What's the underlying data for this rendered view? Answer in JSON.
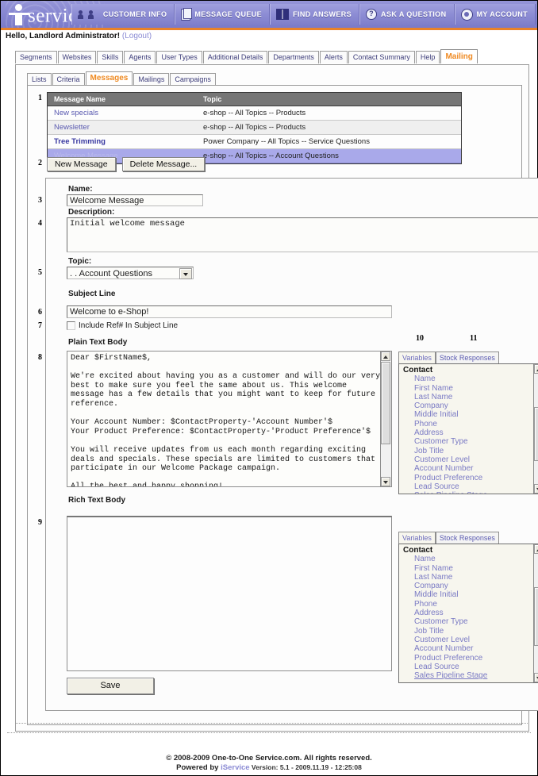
{
  "header": {
    "brand": "service",
    "brand_reg": "®",
    "nav": [
      {
        "label": "CUSTOMER INFO",
        "icon": "people-icon"
      },
      {
        "label": "MESSAGE QUEUE",
        "icon": "document-icon"
      },
      {
        "label": "FIND ANSWERS",
        "icon": "book-icon"
      },
      {
        "label": "ASK A QUESTION",
        "icon": "question-mark-icon"
      },
      {
        "label": "MY ACCOUNT",
        "icon": "account-icon"
      }
    ],
    "greeting": "Hello, Landlord Administrator!",
    "logout": "(Logout)"
  },
  "tabs_primary": [
    {
      "label": "Segments",
      "active": false
    },
    {
      "label": "Websites",
      "active": false
    },
    {
      "label": "Skills",
      "active": false
    },
    {
      "label": "Agents",
      "active": false
    },
    {
      "label": "User Types",
      "active": false
    },
    {
      "label": "Additional Details",
      "active": false
    },
    {
      "label": "Departments",
      "active": false
    },
    {
      "label": "Alerts",
      "active": false
    },
    {
      "label": "Contact Summary",
      "active": false
    },
    {
      "label": "Help",
      "active": false
    },
    {
      "label": "Mailing",
      "active": true
    }
  ],
  "tabs_secondary": [
    {
      "label": "Lists",
      "active": false
    },
    {
      "label": "Criteria",
      "active": false
    },
    {
      "label": "Messages",
      "active": true
    },
    {
      "label": "Mailings",
      "active": false
    },
    {
      "label": "Campaigns",
      "active": false
    }
  ],
  "messages_table": {
    "columns": [
      "Message Name",
      "Topic"
    ],
    "rows": [
      {
        "name": "New specials",
        "topic": "e-shop -- All Topics -- Products",
        "selected": false,
        "alt": false,
        "strong": false
      },
      {
        "name": "Newsletter",
        "topic": "e-shop -- All Topics -- Products",
        "selected": false,
        "alt": true,
        "strong": false
      },
      {
        "name": "Tree Trimming",
        "topic": "Power Company -- All Topics -- Service Questions",
        "selected": false,
        "alt": false,
        "strong": true
      },
      {
        "name": "Welcome Message",
        "topic": "e-shop -- All Topics -- Account Questions",
        "selected": true,
        "alt": false,
        "strong": false
      }
    ]
  },
  "toolbar": {
    "new_message": "New Message",
    "delete_message": "Delete Message..."
  },
  "form": {
    "name_label": "Name:",
    "name_value": "Welcome Message",
    "description_label": "Description:",
    "description_value": "Initial welcome message",
    "topic_label": "Topic:",
    "topic_value": ". . Account Questions",
    "subject_label": "Subject Line",
    "subject_value": "Welcome to e-Shop!",
    "include_ref_label": "Include Ref# In Subject Line",
    "include_ref_checked": false,
    "plain_text_label": "Plain Text Body",
    "plain_text_value": "Dear $FirstName$,\n\nWe're excited about having you as a customer and will do our very\nbest to make sure you feel the same about us. This welcome\nmessage has a few details that you might want to keep for future\nreference.\n\nYour Account Number: $ContactProperty-'Account Number'$\nYour Product Preference: $ContactProperty-'Product Preference'$\n\nYou will receive updates from us each month regarding exciting\ndeals and specials. These specials are limited to customers that\nparticipate in our Welcome Package campaign.\n\nAll the best and happy shopping!",
    "rich_text_label": "Rich Text Body",
    "rich_text_value": "",
    "save_label": "Save"
  },
  "variables_panel": {
    "tab_variables": "Variables",
    "tab_stock_responses": "Stock Responses",
    "group": "Contact",
    "items": [
      "Name",
      "First Name",
      "Last Name",
      "Company",
      "Middle Initial",
      "Phone",
      "Address",
      "Customer Type",
      "Job Title",
      "Customer Level",
      "Account Number",
      "Product Preference",
      "Lead Source",
      "Sales Pipeline Stage"
    ]
  },
  "callouts": {
    "n1": "1",
    "n2": "2",
    "n3": "3",
    "n4": "4",
    "n5": "5",
    "n6": "6",
    "n7": "7",
    "n8": "8",
    "n9": "9",
    "n10": "10",
    "n11": "11"
  },
  "footer": {
    "copyright": "© 2008-2009 One-to-One Service.com. All rights reserved.",
    "powered_prefix": "Powered by ",
    "powered_brand": "iService",
    "version": " Version: 5.1 - 2009.11.19 - 12:25:08"
  },
  "colors": {
    "brand_purple": "#8a8ad4",
    "accent_orange": "#ef8a22",
    "selected_row": "#a9a9ea",
    "link_blue": "#5a5ab0"
  }
}
